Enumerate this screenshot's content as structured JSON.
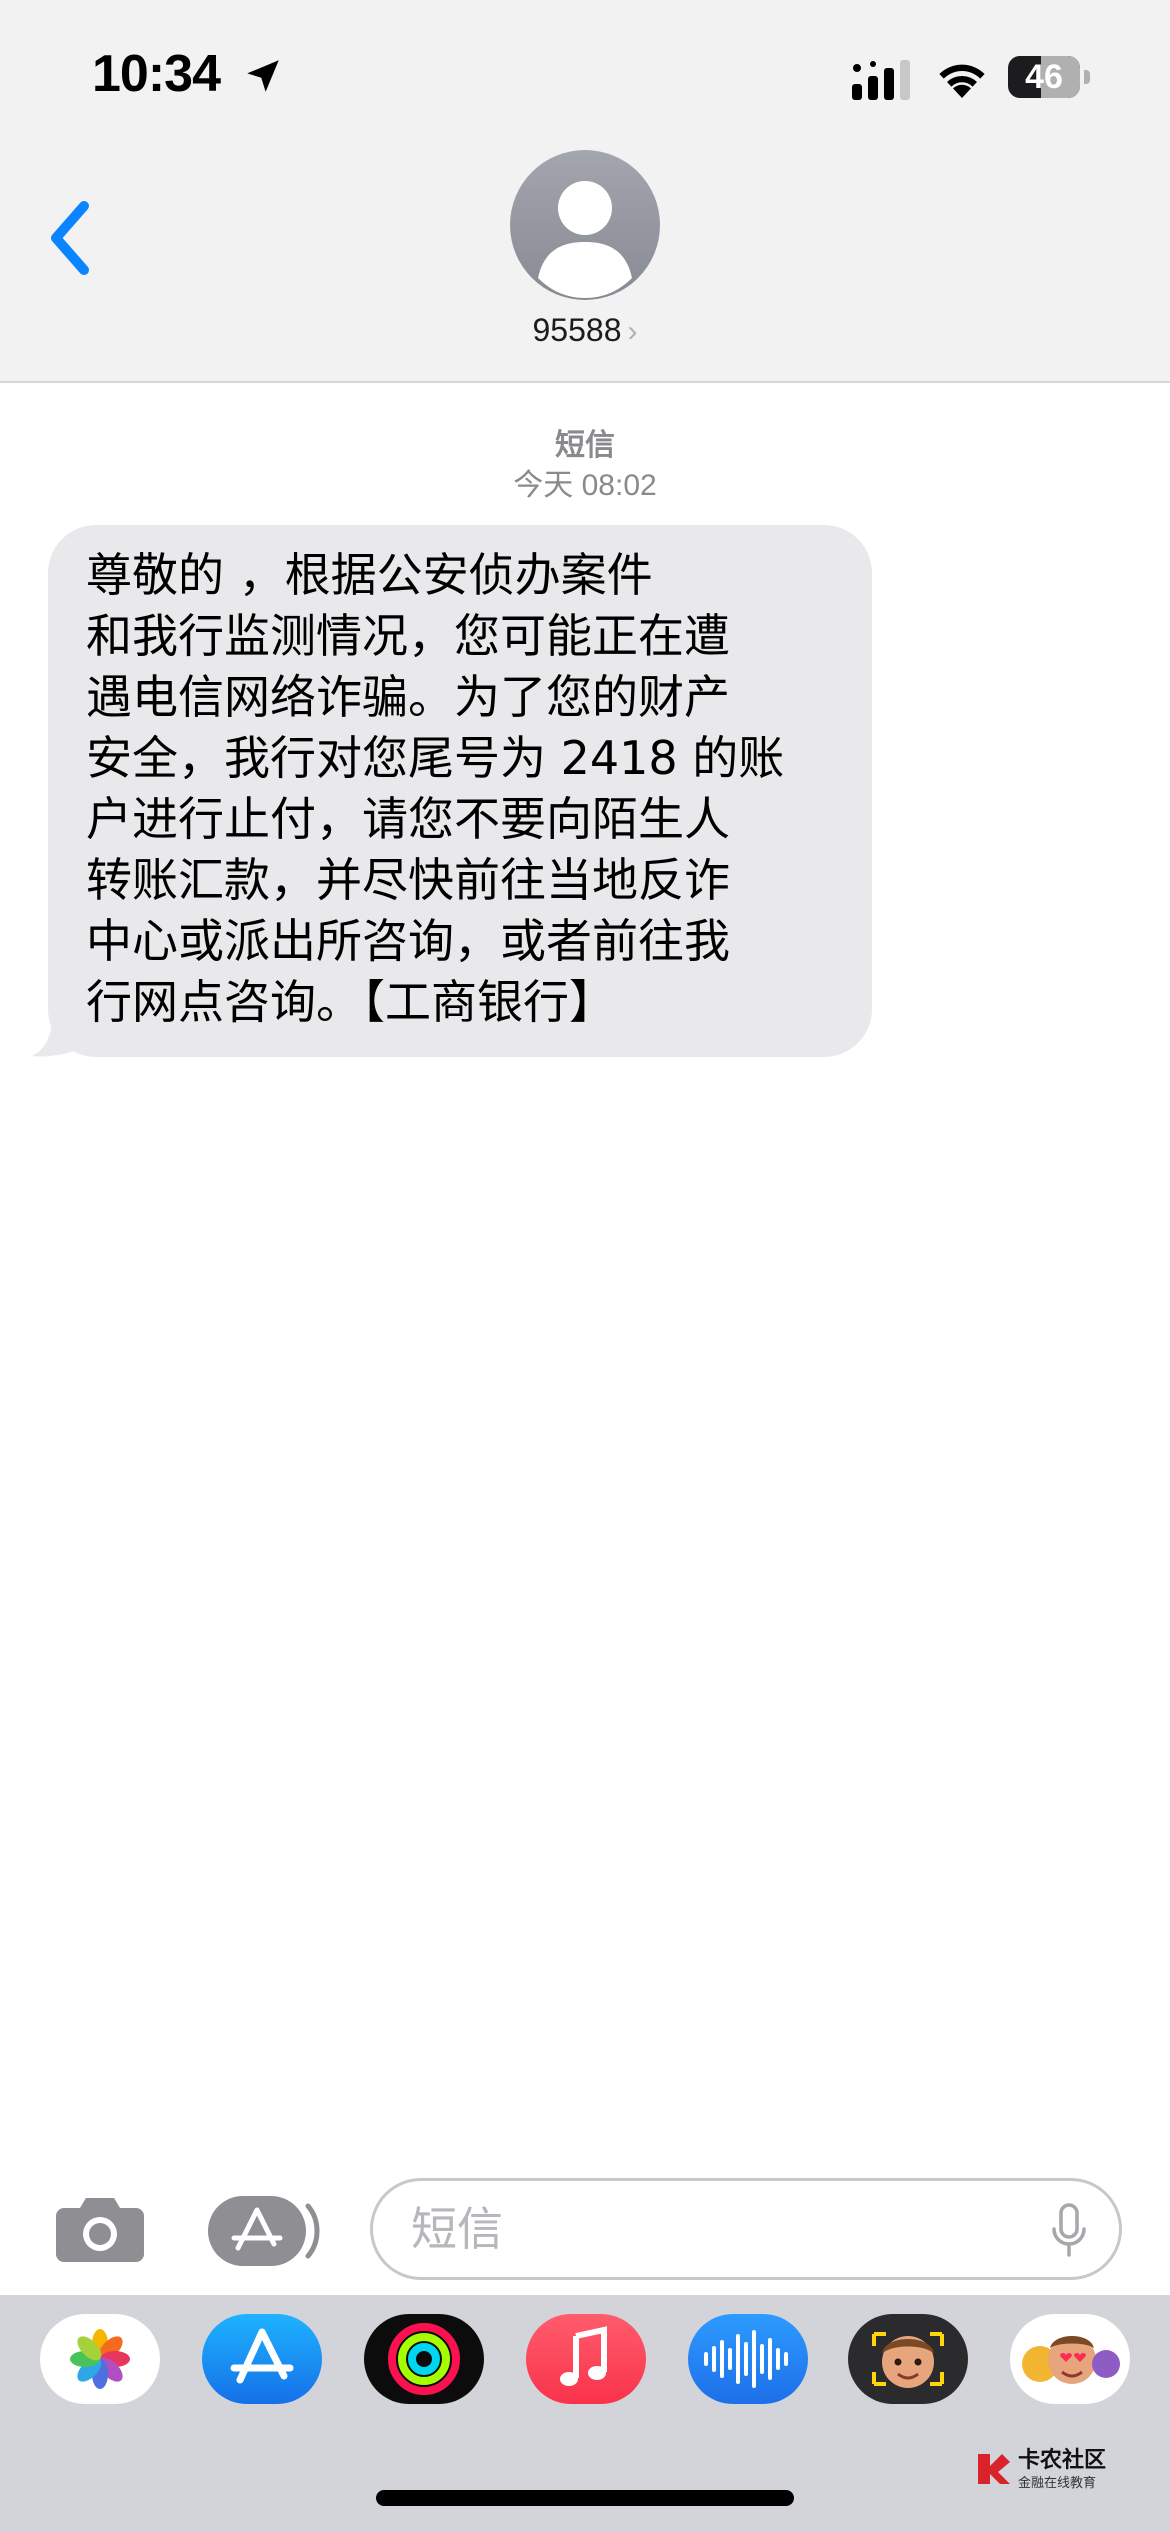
{
  "status_bar": {
    "time": "10:34",
    "battery_level": "46",
    "battery_fraction": 0.46,
    "icons": [
      "location-arrow-icon",
      "cellular-signal-icon",
      "wifi-icon",
      "battery-icon"
    ]
  },
  "header": {
    "back_icon": "chevron-left-icon",
    "avatar_icon": "person-silhouette-icon",
    "contact_name": "95588",
    "contact_chevron": "›"
  },
  "conversation": {
    "service_label": "短信",
    "timestamp": "今天 08:02",
    "messages": [
      {
        "direction": "incoming",
        "text": "尊敬的 ，根据公安侦办案件\n和我行监测情况，您可能正在遭\n遇电信网络诈骗。为了您的财产\n安全，我行对您尾号为 2418 的账\n户进行止付，请您不要向陌生人\n转账汇款，并尽快前往当地反诈\n中心或派出所咨询，或者前往我\n行网点咨询。【工商银行】"
      }
    ]
  },
  "input_bar": {
    "camera_icon": "camera-icon",
    "apps_icon": "app-store-icon",
    "placeholder": "短信",
    "mic_icon": "microphone-icon"
  },
  "app_drawer": {
    "apps": [
      "photos-icon",
      "app-store-icon",
      "fitness-icon",
      "music-icon",
      "voice-memo-icon",
      "memoji-icon",
      "animoji-stickers-icon"
    ]
  },
  "watermark": {
    "title": "卡农社区",
    "subtitle": "金融在线教育"
  },
  "colors": {
    "accent": "#0a84ff",
    "bubble_incoming": "#e9e9eb",
    "header_bg": "#f2f2f2",
    "drawer_bg": "#d2d4da"
  }
}
